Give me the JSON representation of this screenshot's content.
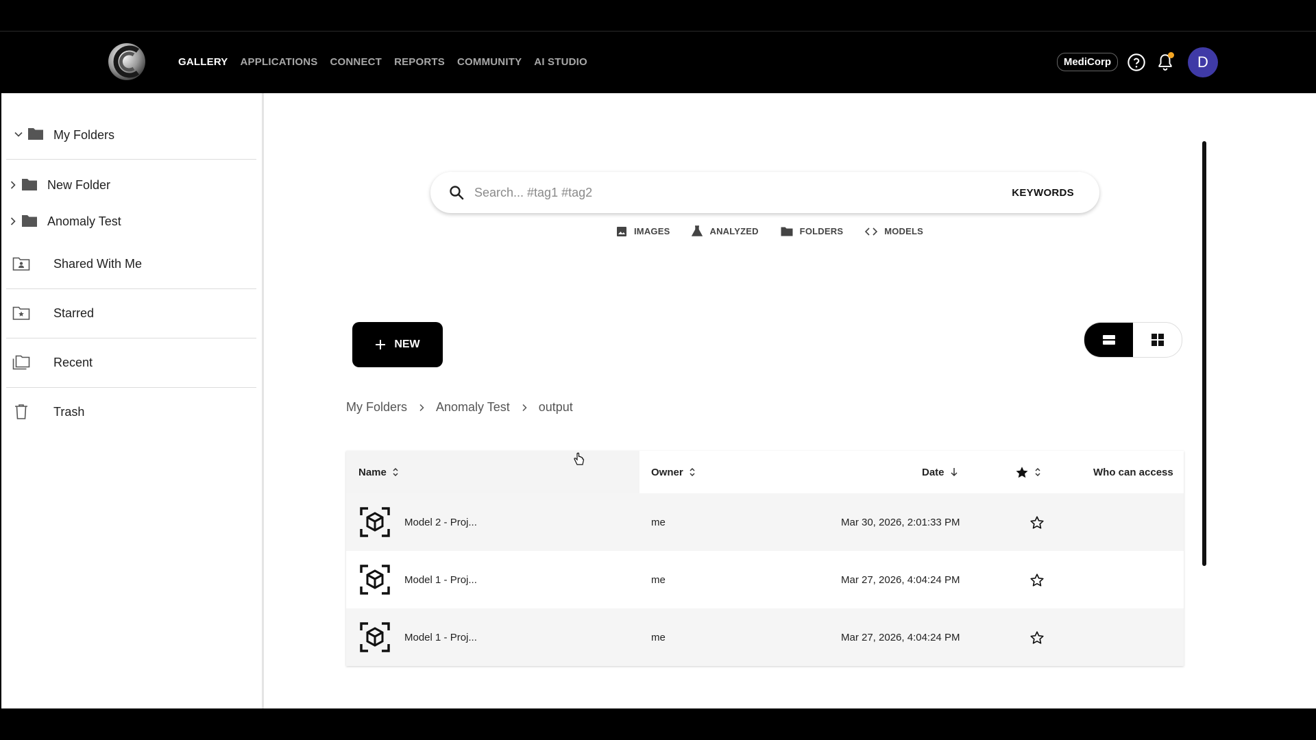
{
  "nav": {
    "items": [
      {
        "label": "GALLERY",
        "active": true
      },
      {
        "label": "APPLICATIONS",
        "active": false
      },
      {
        "label": "CONNECT",
        "active": false
      },
      {
        "label": "REPORTS",
        "active": false
      },
      {
        "label": "COMMUNITY",
        "active": false
      },
      {
        "label": "AI STUDIO",
        "active": false
      }
    ],
    "org": "MediCorp",
    "avatar_initial": "D",
    "notification_dot_color": "#f5a623"
  },
  "sidebar": {
    "my_folders": "My Folders",
    "folders": [
      {
        "label": "New Folder"
      },
      {
        "label": "Anomaly Test"
      }
    ],
    "shared": "Shared With Me",
    "starred": "Starred",
    "recent": "Recent",
    "trash": "Trash"
  },
  "search": {
    "placeholder": "Search... #tag1 #tag2",
    "keywords_label": "KEYWORDS"
  },
  "filters": {
    "images": "IMAGES",
    "analyzed": "ANALYZED",
    "folders": "FOLDERS",
    "models": "MODELS"
  },
  "new_button": "NEW",
  "breadcrumb": [
    "My Folders",
    "Anomaly Test",
    "output"
  ],
  "table": {
    "headers": {
      "name": "Name",
      "owner": "Owner",
      "date": "Date",
      "access": "Who can access"
    },
    "rows": [
      {
        "name": "Model 2 - Proj...",
        "owner": "me",
        "date": "Mar 30, 2026, 2:01:33 PM",
        "starred": false
      },
      {
        "name": "Model 1 - Proj...",
        "owner": "me",
        "date": "Mar 27, 2026, 4:04:24 PM",
        "starred": false
      },
      {
        "name": "Model 1 - Proj...",
        "owner": "me",
        "date": "Mar 27, 2026, 4:04:24 PM",
        "starred": false
      }
    ]
  }
}
